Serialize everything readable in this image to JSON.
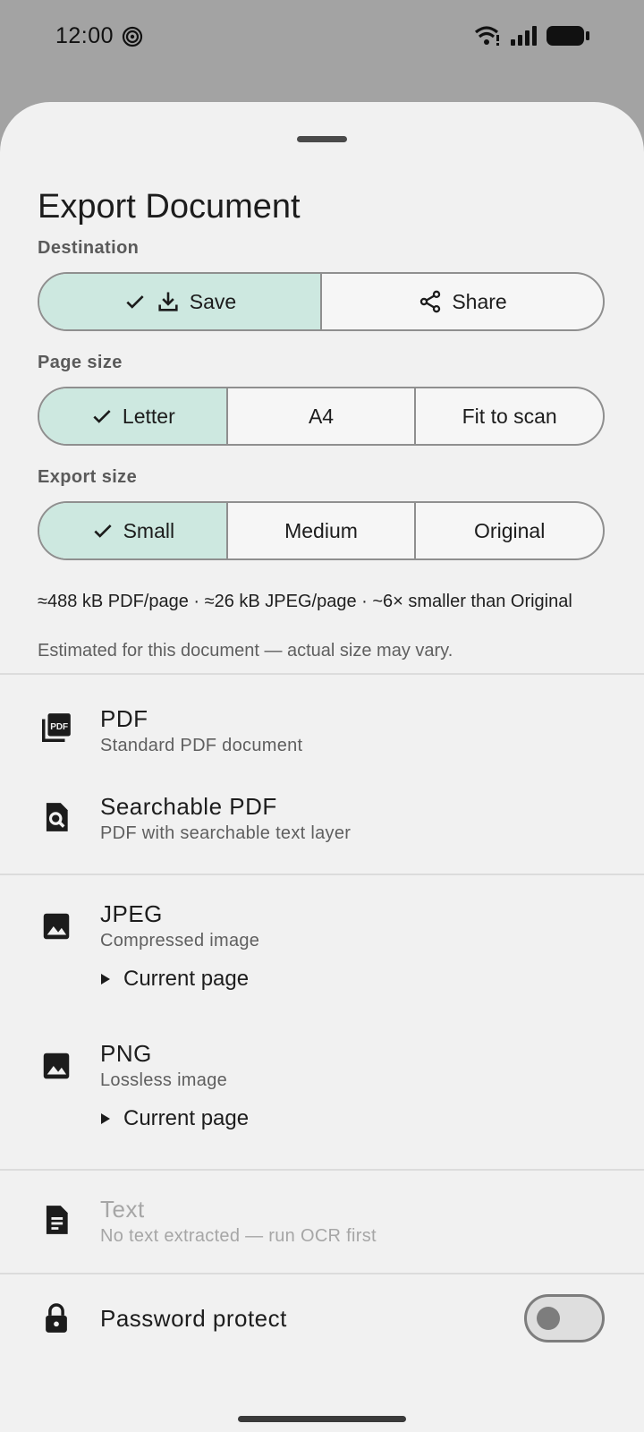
{
  "status_bar": {
    "time": "12:00"
  },
  "sheet": {
    "title": "Export Document",
    "destination": {
      "label": "Destination",
      "options": [
        {
          "label": "Save",
          "icon": "download-icon",
          "selected": true
        },
        {
          "label": "Share",
          "icon": "share-icon",
          "selected": false
        }
      ]
    },
    "page_size": {
      "label": "Page size",
      "options": [
        {
          "label": "Letter",
          "selected": true
        },
        {
          "label": "A4",
          "selected": false
        },
        {
          "label": "Fit to scan",
          "selected": false
        }
      ]
    },
    "export_size": {
      "label": "Export size",
      "options": [
        {
          "label": "Small",
          "selected": true
        },
        {
          "label": "Medium",
          "selected": false
        },
        {
          "label": "Original",
          "selected": false
        }
      ]
    },
    "size_info": "≈488 kB PDF/page · ≈26 kB JPEG/page · ~6× smaller than Original",
    "size_note": "Estimated for this document — actual size may vary."
  },
  "formats": [
    {
      "title": "PDF",
      "subtitle": "Standard PDF document",
      "icon": "pdf-icon"
    },
    {
      "title": "Searchable PDF",
      "subtitle": "PDF with searchable text layer",
      "icon": "search-document-icon"
    },
    {
      "title": "JPEG",
      "subtitle": "Compressed image",
      "icon": "image-icon",
      "scope": "Current page"
    },
    {
      "title": "PNG",
      "subtitle": "Lossless image",
      "icon": "image-icon",
      "scope": "Current page"
    },
    {
      "title": "Text",
      "subtitle": "No text extracted — run OCR first",
      "icon": "text-document-icon",
      "disabled": true
    }
  ],
  "password": {
    "label": "Password protect",
    "icon": "lock-icon",
    "enabled": false
  },
  "colors": {
    "accent_selected": "#cde8e0",
    "sheet_bg": "#f1f1f1",
    "scrim": "#a3a3a3"
  }
}
